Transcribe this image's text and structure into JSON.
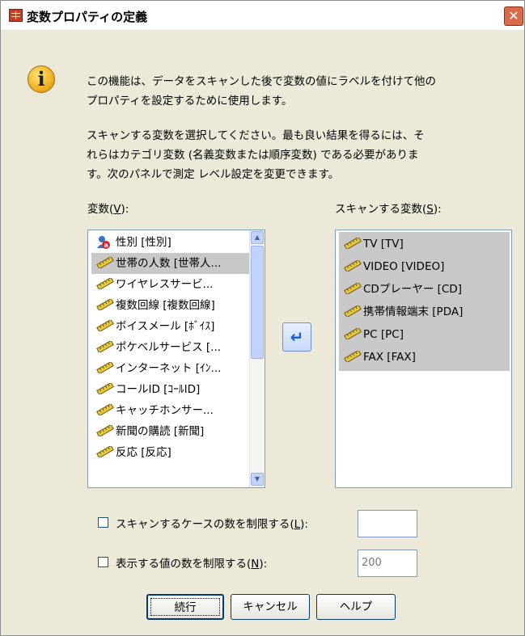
{
  "window": {
    "title": "変数プロパティの定義",
    "close_glyph": "✕"
  },
  "info_text": {
    "line1": "この機能は、データをスキャンした後で変数の値にラベルを付けて他の",
    "line2": "プロパティを設定するために使用します。",
    "line3": "スキャンする変数を選択してください。最も良い結果を得るには、そ",
    "line4": "れらはカテゴリ変数 (名義変数または順序変数) である必要がありま",
    "line5": "す。次のパネルで測定 レベル設定を変更できます。"
  },
  "variables": {
    "label_prefix": "変数(",
    "label_mnemonic": "V",
    "label_suffix": "):",
    "items": [
      {
        "label": "性別 [性別]",
        "icon": "nominal-icon"
      },
      {
        "label": "世帯の人数 [世帯人...",
        "icon": "scale-ruler-icon"
      },
      {
        "label": "ワイヤレスサービ...",
        "icon": "scale-ruler-icon"
      },
      {
        "label": "複数回線 [複数回線]",
        "icon": "scale-ruler-icon"
      },
      {
        "label": "ボイスメール [ﾎﾞｲｽ]",
        "icon": "scale-ruler-icon"
      },
      {
        "label": "ポケベルサービス [...",
        "icon": "scale-ruler-icon"
      },
      {
        "label": "インターネット [ｲﾝ...",
        "icon": "scale-ruler-icon"
      },
      {
        "label": "コールID [ｺｰﾙID]",
        "icon": "scale-ruler-icon"
      },
      {
        "label": "キャッチホンサー...",
        "icon": "scale-ruler-icon"
      },
      {
        "label": "新聞の購読 [新聞]",
        "icon": "scale-ruler-icon"
      },
      {
        "label": "反応 [反応]",
        "icon": "scale-ruler-icon"
      }
    ],
    "selected_index": 1
  },
  "scan_variables": {
    "label_prefix": "スキャンする変数(",
    "label_mnemonic": "S",
    "label_suffix": "):",
    "items": [
      {
        "label": "TV [TV]",
        "icon": "scale-ruler-icon"
      },
      {
        "label": "VIDEO [VIDEO]",
        "icon": "scale-ruler-icon"
      },
      {
        "label": "CDプレーヤー [CD]",
        "icon": "scale-ruler-icon"
      },
      {
        "label": "携帯情報端末 [PDA]",
        "icon": "scale-ruler-icon"
      },
      {
        "label": "PC [PC]",
        "icon": "scale-ruler-icon"
      },
      {
        "label": "FAX [FAX]",
        "icon": "scale-ruler-icon"
      }
    ]
  },
  "move_button": {
    "icon": "move-arrow-icon",
    "glyph": "↵"
  },
  "limit_cases": {
    "label_prefix": "スキャンするケースの数を制限する(",
    "label_mnemonic": "L",
    "label_suffix": "):",
    "checked": false,
    "value": ""
  },
  "limit_values": {
    "label_prefix": "表示する値の数を制限する(",
    "label_mnemonic": "N",
    "label_suffix": "):",
    "checked": false,
    "value": "200"
  },
  "buttons": {
    "continue": "続行",
    "cancel": "キャンセル",
    "help": "ヘルプ"
  },
  "colors": {
    "dialog_bg": "#ece9d8",
    "selection_bg": "#c8c8c8",
    "scroll_accent": "#c1d3fb",
    "close_red": "#d96a4a"
  }
}
